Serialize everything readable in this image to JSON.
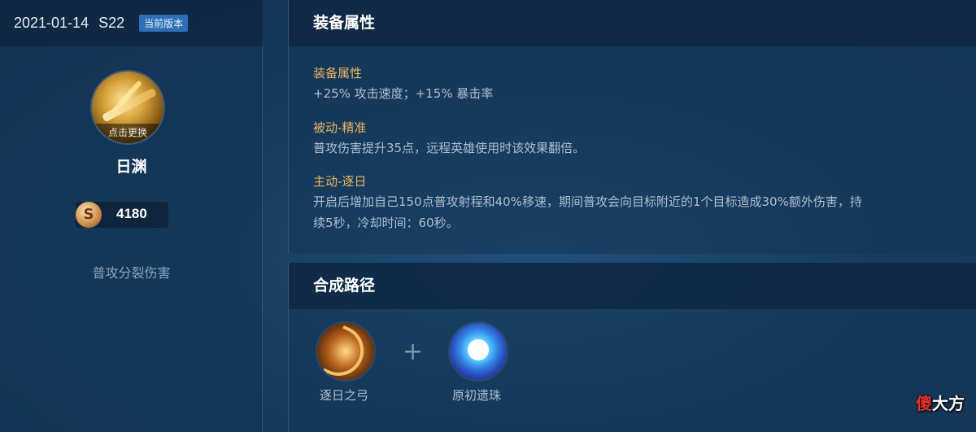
{
  "left_panel": {
    "date": "2021-01-14",
    "season": "S22",
    "version_badge": "当前版本",
    "change_label": "点击更换",
    "item_name": "日渊",
    "price": "4180",
    "coin_icon": "gold-coin-icon",
    "description": "普攻分裂伤害"
  },
  "attributes": {
    "header": "装备属性",
    "sections": [
      {
        "title": "装备属性",
        "lines": [
          "+25% 攻击速度；+15% 暴击率"
        ]
      },
      {
        "title": "被动-精准",
        "lines": [
          "普攻伤害提升35点，远程英雄使用时该效果翻倍。"
        ]
      },
      {
        "title": "主动-逐日",
        "lines": [
          "开启后增加自己150点普攻射程和40%移速，期间普攻会向目标附近的1个目标造成30%额外伤害，持",
          "续5秒，冷却时间：60秒。"
        ]
      }
    ]
  },
  "recipe": {
    "header": "合成路径",
    "plus": "+",
    "items": [
      {
        "name": "逐日之弓",
        "icon": "bow-icon"
      },
      {
        "name": "原初遗珠",
        "icon": "orb-icon"
      }
    ]
  },
  "watermark": {
    "part1": "傻",
    "part2": "大方"
  },
  "colors": {
    "accent_gold": "#e9b55d",
    "badge_blue": "#2f6fb8",
    "text": "#aebfd0"
  }
}
